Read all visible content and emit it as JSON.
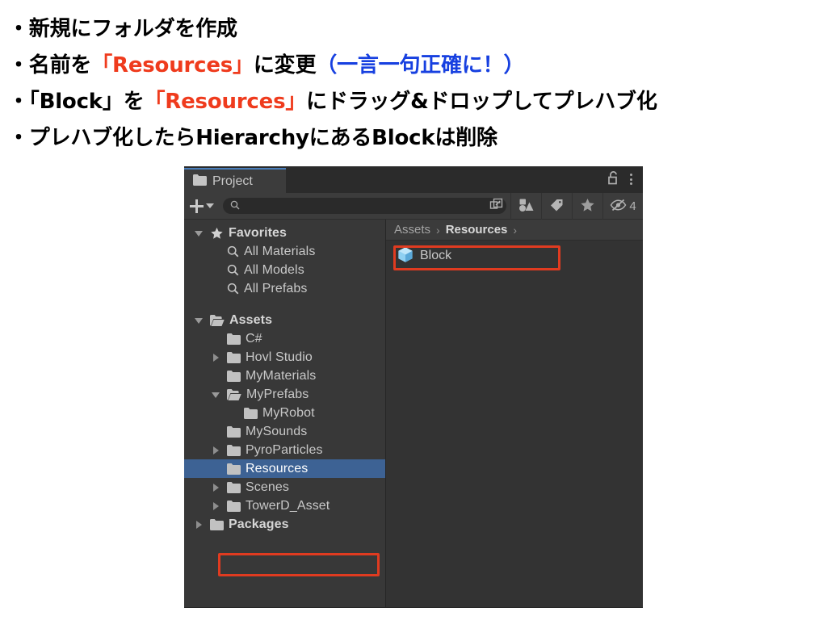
{
  "instructions": {
    "lines": [
      {
        "segments": [
          {
            "text": "・新規にフォルダを作成",
            "color": "black"
          }
        ]
      },
      {
        "segments": [
          {
            "text": "・名前を",
            "color": "black"
          },
          {
            "text": "「Resources」",
            "color": "red"
          },
          {
            "text": "に変更",
            "color": "black"
          },
          {
            "text": "（一言一句正確に！）",
            "color": "blue"
          }
        ]
      },
      {
        "segments": [
          {
            "text": "・「Block」を",
            "color": "black"
          },
          {
            "text": "「Resources」",
            "color": "red"
          },
          {
            "text": "にドラッグ&ドロップしてプレハブ化",
            "color": "black"
          }
        ]
      },
      {
        "segments": [
          {
            "text": "・プレハブ化したらHierarchyにあるBlockは削除",
            "color": "black"
          }
        ]
      }
    ],
    "colors": {
      "black": "#000000",
      "red": "#ef3b1d",
      "blue": "#1740e0"
    }
  },
  "project_window": {
    "tab": {
      "label": "Project",
      "icon": "folder-icon",
      "accent_color": "#4a7ebb"
    },
    "tabbar_right": {
      "lock_icon": "unlocked-padlock-icon",
      "menu_icon": "kebab-menu-icon"
    },
    "toolbar": {
      "create_label": "+",
      "create_dropdown_icon": "chevron-down-icon",
      "search": {
        "value": "",
        "placeholder": "",
        "icon": "search-icon",
        "popout_icon": "popout-window-icon"
      },
      "filters": [
        {
          "name": "type-filter",
          "icon": "shapes-icon"
        },
        {
          "name": "label-filter",
          "icon": "tag-icon"
        },
        {
          "name": "favorites-filter",
          "icon": "star-icon"
        }
      ],
      "hidden_toggle": {
        "icon": "eye-off-icon",
        "count": "4"
      }
    },
    "tree": [
      {
        "label": "Favorites",
        "icon": "star-icon",
        "indent": 0,
        "twisty": "open",
        "bold": true,
        "selected": false
      },
      {
        "label": "All Materials",
        "icon": "search-icon",
        "indent": 1,
        "twisty": "none",
        "bold": false,
        "selected": false
      },
      {
        "label": "All Models",
        "icon": "search-icon",
        "indent": 1,
        "twisty": "none",
        "bold": false,
        "selected": false
      },
      {
        "label": "All Prefabs",
        "icon": "search-icon",
        "indent": 1,
        "twisty": "none",
        "bold": false,
        "selected": false
      },
      {
        "label": "",
        "icon": "none",
        "indent": 0,
        "twisty": "none",
        "bold": false,
        "selected": false
      },
      {
        "label": "Assets",
        "icon": "folder-open-icon",
        "indent": 0,
        "twisty": "open",
        "bold": true,
        "selected": false
      },
      {
        "label": "C#",
        "icon": "folder-icon",
        "indent": 1,
        "twisty": "none",
        "bold": false,
        "selected": false
      },
      {
        "label": "Hovl Studio",
        "icon": "folder-icon",
        "indent": 1,
        "twisty": "closed",
        "bold": false,
        "selected": false
      },
      {
        "label": "MyMaterials",
        "icon": "folder-icon",
        "indent": 1,
        "twisty": "none",
        "bold": false,
        "selected": false
      },
      {
        "label": "MyPrefabs",
        "icon": "folder-open-icon",
        "indent": 1,
        "twisty": "open",
        "bold": false,
        "selected": false
      },
      {
        "label": "MyRobot",
        "icon": "folder-icon",
        "indent": 2,
        "twisty": "none",
        "bold": false,
        "selected": false
      },
      {
        "label": "MySounds",
        "icon": "folder-icon",
        "indent": 1,
        "twisty": "none",
        "bold": false,
        "selected": false
      },
      {
        "label": "PyroParticles",
        "icon": "folder-icon",
        "indent": 1,
        "twisty": "closed",
        "bold": false,
        "selected": false
      },
      {
        "label": "Resources",
        "icon": "folder-icon",
        "indent": 1,
        "twisty": "none",
        "bold": false,
        "selected": true
      },
      {
        "label": "Scenes",
        "icon": "folder-icon",
        "indent": 1,
        "twisty": "closed",
        "bold": false,
        "selected": false
      },
      {
        "label": "TowerD_Asset",
        "icon": "folder-icon",
        "indent": 1,
        "twisty": "closed",
        "bold": false,
        "selected": false
      },
      {
        "label": "Packages",
        "icon": "folder-icon",
        "indent": 0,
        "twisty": "closed",
        "bold": true,
        "selected": false
      }
    ],
    "content": {
      "breadcrumb": [
        {
          "label": "Assets",
          "current": false
        },
        {
          "label": "Resources",
          "current": true
        }
      ],
      "breadcrumb_separator": "›",
      "trailing_separator": "›",
      "assets": [
        {
          "label": "Block",
          "icon": "prefab-cube-icon"
        }
      ]
    },
    "annotations": {
      "highlight_color": "#e03b20",
      "selection_color": "#3d6294",
      "boxes": [
        {
          "name": "block-highlight"
        },
        {
          "name": "resources-highlight"
        }
      ]
    }
  }
}
